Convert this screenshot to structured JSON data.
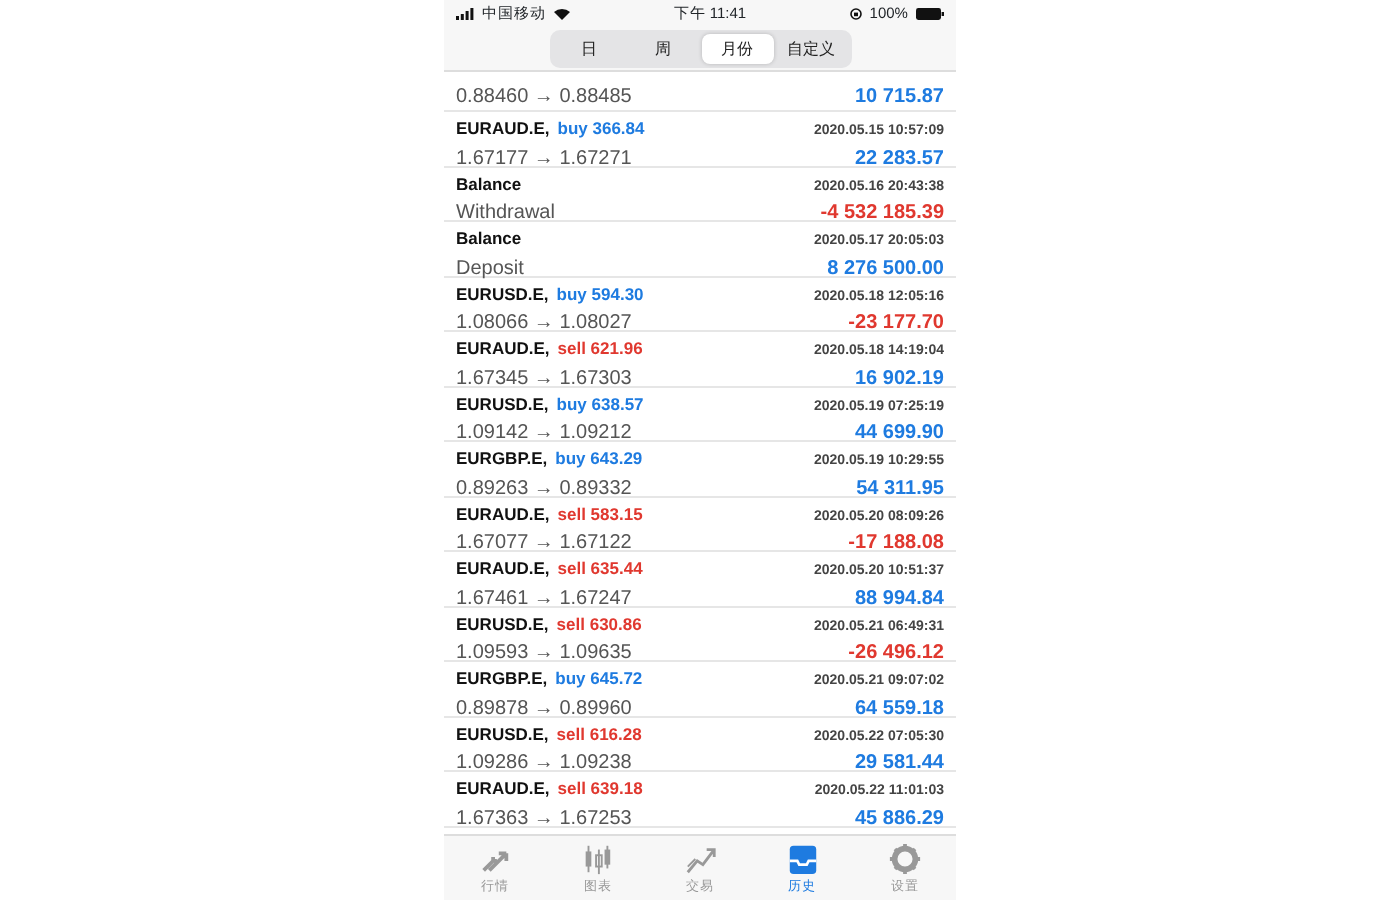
{
  "status_bar": {
    "carrier": "中国移动",
    "time": "下午 11:41",
    "battery": "100%"
  },
  "segments": [
    {
      "label": "日",
      "selected": false
    },
    {
      "label": "周",
      "selected": false
    },
    {
      "label": "月份",
      "selected": true
    },
    {
      "label": "自定义",
      "selected": false
    }
  ],
  "partial_row": {
    "prices": "0.88460 → 0.88485",
    "profit": "10 715.87",
    "loss": false
  },
  "rows": [
    {
      "kind": "trade",
      "symbol": "EURAUD.E,",
      "side": "buy 366.84",
      "short": false,
      "time": "2020.05.15 10:57:09",
      "prices": "1.67177 → 1.67271",
      "profit": "22 283.57",
      "loss": false
    },
    {
      "kind": "balance",
      "symbol": "Balance",
      "time": "2020.05.16 20:43:38",
      "prices": "Withdrawal",
      "profit": "-4 532 185.39",
      "loss": true
    },
    {
      "kind": "balance",
      "symbol": "Balance",
      "time": "2020.05.17 20:05:03",
      "prices": "Deposit",
      "profit": "8 276 500.00",
      "loss": false
    },
    {
      "kind": "trade",
      "symbol": "EURUSD.E,",
      "side": "buy 594.30",
      "short": false,
      "time": "2020.05.18 12:05:16",
      "prices": "1.08066 → 1.08027",
      "profit": "-23 177.70",
      "loss": true
    },
    {
      "kind": "trade",
      "symbol": "EURAUD.E,",
      "side": "sell 621.96",
      "short": true,
      "time": "2020.05.18 14:19:04",
      "prices": "1.67345 → 1.67303",
      "profit": "16 902.19",
      "loss": false
    },
    {
      "kind": "trade",
      "symbol": "EURUSD.E,",
      "side": "buy 638.57",
      "short": false,
      "time": "2020.05.19 07:25:19",
      "prices": "1.09142 → 1.09212",
      "profit": "44 699.90",
      "loss": false
    },
    {
      "kind": "trade",
      "symbol": "EURGBP.E,",
      "side": "buy 643.29",
      "short": false,
      "time": "2020.05.19 10:29:55",
      "prices": "0.89263 → 0.89332",
      "profit": "54 311.95",
      "loss": false
    },
    {
      "kind": "trade",
      "symbol": "EURAUD.E,",
      "side": "sell 583.15",
      "short": true,
      "time": "2020.05.20 08:09:26",
      "prices": "1.67077 → 1.67122",
      "profit": "-17 188.08",
      "loss": true
    },
    {
      "kind": "trade",
      "symbol": "EURAUD.E,",
      "side": "sell 635.44",
      "short": true,
      "time": "2020.05.20 10:51:37",
      "prices": "1.67461 → 1.67247",
      "profit": "88 994.84",
      "loss": false
    },
    {
      "kind": "trade",
      "symbol": "EURUSD.E,",
      "side": "sell 630.86",
      "short": true,
      "time": "2020.05.21 06:49:31",
      "prices": "1.09593 → 1.09635",
      "profit": "-26 496.12",
      "loss": true
    },
    {
      "kind": "trade",
      "symbol": "EURGBP.E,",
      "side": "buy 645.72",
      "short": false,
      "time": "2020.05.21 09:07:02",
      "prices": "0.89878 → 0.89960",
      "profit": "64 559.18",
      "loss": false
    },
    {
      "kind": "trade",
      "symbol": "EURUSD.E,",
      "side": "sell 616.28",
      "short": true,
      "time": "2020.05.22 07:05:30",
      "prices": "1.09286 → 1.09238",
      "profit": "29 581.44",
      "loss": false
    },
    {
      "kind": "trade",
      "symbol": "EURAUD.E,",
      "side": "sell 639.18",
      "short": true,
      "time": "2020.05.22 11:01:03",
      "prices": "1.67363 → 1.67253",
      "profit": "45 886.29",
      "loss": false
    }
  ],
  "tab_bar": [
    {
      "kind": "quotes",
      "label": "行情",
      "selected": false
    },
    {
      "kind": "chart",
      "label": "图表",
      "selected": false
    },
    {
      "kind": "trade",
      "label": "交易",
      "selected": false
    },
    {
      "kind": "history",
      "label": "历史",
      "selected": true
    },
    {
      "kind": "settings",
      "label": "设置",
      "selected": false
    }
  ]
}
